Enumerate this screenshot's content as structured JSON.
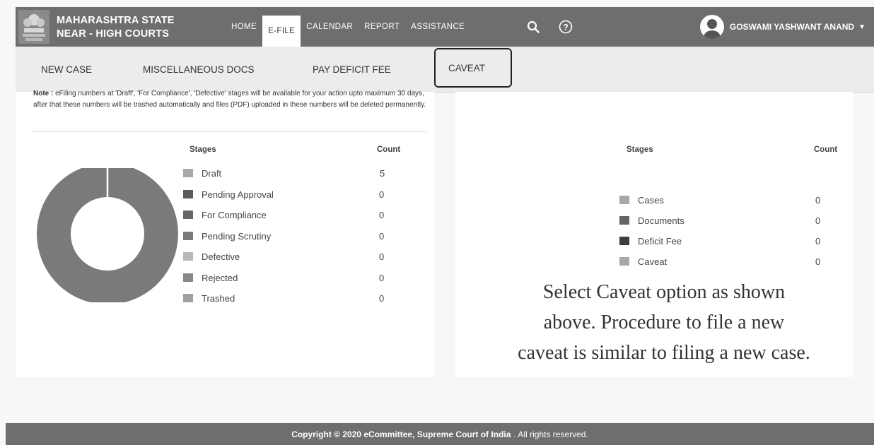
{
  "header": {
    "brand_line1": "MAHARASHTRA STATE",
    "brand_line2": "NEAR - HIGH COURTS",
    "nav": [
      {
        "label": "HOME"
      },
      {
        "label": "E-FILE"
      },
      {
        "label": "CALENDAR"
      },
      {
        "label": "REPORT"
      },
      {
        "label": "ASSISTANCE"
      }
    ],
    "user_name": "GOSWAMI YASHWANT ANAND",
    "user_caret": "▼"
  },
  "submenu": {
    "items": [
      {
        "label": "NEW CASE"
      },
      {
        "label": "MISCELLANEOUS DOCS"
      },
      {
        "label": "PAY DEFICIT FEE"
      },
      {
        "label": "CAVEAT"
      }
    ]
  },
  "left_panel": {
    "note_label": "Note :",
    "note_text": " eFiling numbers at 'Draft', 'For Compliance', 'Defective' stages will be available for your action upto maximum 30 days, after that these numbers will be trashed automatically and files (PDF) uploaded in these numbers will be deleted permanently.",
    "stages_header": "Stages",
    "count_header": "Count",
    "rows": [
      {
        "label": "Draft",
        "count": "5",
        "color": "#a8a8a8"
      },
      {
        "label": "Pending Approval",
        "count": "0",
        "color": "#5a5a5a"
      },
      {
        "label": "For Compliance",
        "count": "0",
        "color": "#666666"
      },
      {
        "label": "Pending Scrutiny",
        "count": "0",
        "color": "#7a7a7a"
      },
      {
        "label": "Defective",
        "count": "0",
        "color": "#b8b8b8"
      },
      {
        "label": "Rejected",
        "count": "0",
        "color": "#888888"
      },
      {
        "label": "Trashed",
        "count": "0",
        "color": "#a0a0a0"
      }
    ]
  },
  "right_panel": {
    "stages_header": "Stages",
    "count_header": "Count",
    "rows": [
      {
        "label": "Cases",
        "count": "0",
        "color": "#a8a8a8"
      },
      {
        "label": "Documents",
        "count": "0",
        "color": "#666666"
      },
      {
        "label": "Deficit Fee",
        "count": "0",
        "color": "#3e3e3e"
      },
      {
        "label": "Caveat",
        "count": "0",
        "color": "#a8a8a8"
      }
    ],
    "instruction_lines": [
      "Select Caveat option as shown",
      "above. Procedure to file a new",
      "caveat is similar to filing a new case."
    ]
  },
  "footer": {
    "copyright": "Copyright © 2020 eCommittee, Supreme Court of India",
    "rights": ". All rights reserved."
  },
  "colors": {
    "topbar": "#6e6e6e",
    "submenu": "#ececec",
    "donut": "#7a7a7a"
  },
  "icons": {
    "emblem": "state-emblem-icon",
    "search": "search-icon",
    "help": "help-circle-icon",
    "user": "user-avatar-icon"
  }
}
